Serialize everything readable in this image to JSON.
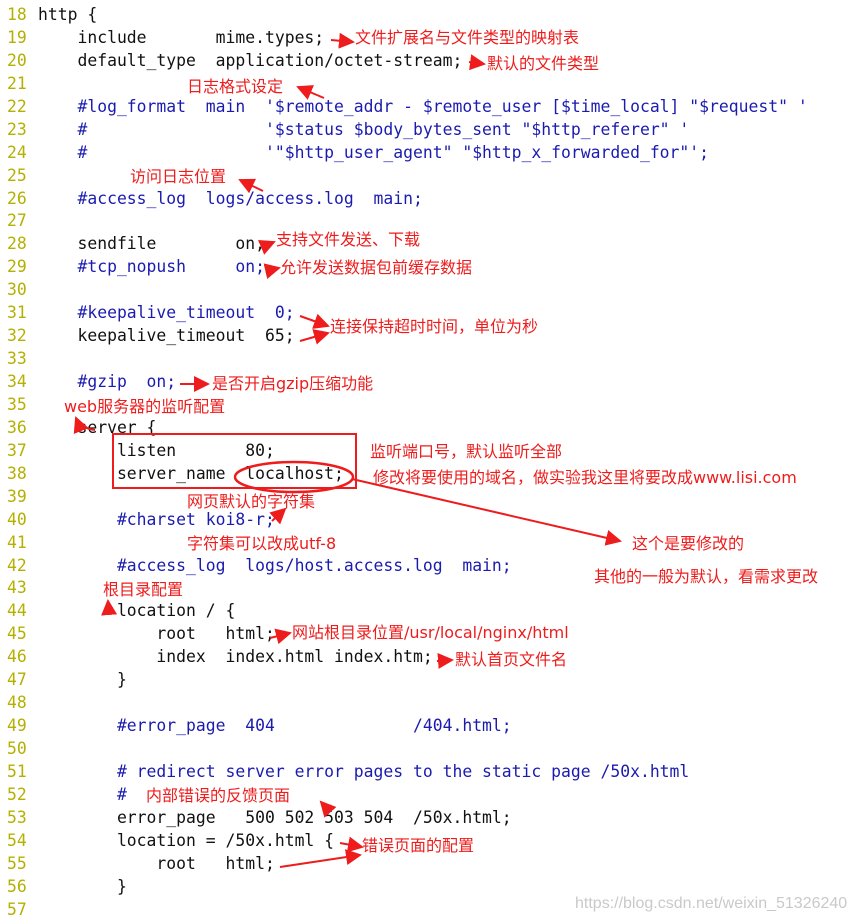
{
  "code_lines": [
    {
      "n": "18",
      "text": "http {",
      "comment": false
    },
    {
      "n": "19",
      "text": "    include       mime.types;",
      "comment": false
    },
    {
      "n": "20",
      "text": "    default_type  application/octet-stream;",
      "comment": false
    },
    {
      "n": "21",
      "text": "",
      "comment": false
    },
    {
      "n": "22",
      "text": "    #log_format  main  '$remote_addr - $remote_user [$time_local] \"$request\" '",
      "comment": true
    },
    {
      "n": "23",
      "text": "    #                  '$status $body_bytes_sent \"$http_referer\" '",
      "comment": true
    },
    {
      "n": "24",
      "text": "    #                  '\"$http_user_agent\" \"$http_x_forwarded_for\"';",
      "comment": true
    },
    {
      "n": "25",
      "text": "",
      "comment": false
    },
    {
      "n": "26",
      "text": "    #access_log  logs/access.log  main;",
      "comment": true
    },
    {
      "n": "27",
      "text": "",
      "comment": false
    },
    {
      "n": "28",
      "text": "    sendfile        on;",
      "comment": false
    },
    {
      "n": "29",
      "text": "    #tcp_nopush     on;",
      "comment": true
    },
    {
      "n": "30",
      "text": "",
      "comment": false
    },
    {
      "n": "31",
      "text": "    #keepalive_timeout  0;",
      "comment": true
    },
    {
      "n": "32",
      "text": "    keepalive_timeout  65;",
      "comment": false
    },
    {
      "n": "33",
      "text": "",
      "comment": false
    },
    {
      "n": "34",
      "text": "    #gzip  on;",
      "comment": true
    },
    {
      "n": "35",
      "text": "",
      "comment": false
    },
    {
      "n": "36",
      "text": "    server {",
      "comment": false
    },
    {
      "n": "37",
      "text": "        listen       80;",
      "comment": false
    },
    {
      "n": "38",
      "text": "        server_name  localhost;",
      "comment": false
    },
    {
      "n": "39",
      "text": "",
      "comment": false
    },
    {
      "n": "40",
      "text": "        #charset koi8-r;",
      "comment": true
    },
    {
      "n": "41",
      "text": "",
      "comment": false
    },
    {
      "n": "42",
      "text": "        #access_log  logs/host.access.log  main;",
      "comment": true
    },
    {
      "n": "43",
      "text": "",
      "comment": false
    },
    {
      "n": "44",
      "text": "        location / {",
      "comment": false
    },
    {
      "n": "45",
      "text": "            root   html;",
      "comment": false
    },
    {
      "n": "46",
      "text": "            index  index.html index.htm;",
      "comment": false
    },
    {
      "n": "47",
      "text": "        }",
      "comment": false
    },
    {
      "n": "48",
      "text": "",
      "comment": false
    },
    {
      "n": "49",
      "text": "        #error_page  404              /404.html;",
      "comment": true
    },
    {
      "n": "50",
      "text": "",
      "comment": false
    },
    {
      "n": "51",
      "text": "        # redirect server error pages to the static page /50x.html",
      "comment": true
    },
    {
      "n": "52",
      "text": "        #",
      "comment": true
    },
    {
      "n": "53",
      "text": "        error_page   500 502 503 504  /50x.html;",
      "comment": false
    },
    {
      "n": "54",
      "text": "        location = /50x.html {",
      "comment": false
    },
    {
      "n": "55",
      "text": "            root   html;",
      "comment": false
    },
    {
      "n": "56",
      "text": "        }",
      "comment": false
    },
    {
      "n": "57",
      "text": "",
      "comment": false
    }
  ],
  "annotations": {
    "mime": "文件扩展名与文件类型的映射表",
    "default_type": "默认的文件类型",
    "log_format": "日志格式设定",
    "access_log": "访问日志位置",
    "sendfile": "支持文件发送、下载",
    "tcp_nopush": "允许发送数据包前缓存数据",
    "keepalive": "连接保持超时时间，单位为秒",
    "gzip": "是否开启gzip压缩功能",
    "server": "web服务器的监听配置",
    "listen": "监听端口号，默认监听全部",
    "server_name": "修改将要使用的域名，做实验我这里将要改成www.lisi.com",
    "charset": "网页默认的字符集",
    "charset_utf8": "字符集可以改成utf-8",
    "must_modify": "这个是要修改的",
    "others_default": "其他的一般为默认，看需求更改",
    "location_root": "根目录配置",
    "root": "网站根目录位置/usr/local/nginx/html",
    "index": "默认首页文件名",
    "internal_error": "内部错误的反馈页面",
    "error_page_config": "错误页面的配置"
  },
  "watermark": "https://blog.csdn.net/weixin_51326240",
  "colors": {
    "annotation": "#ee1c1c",
    "comment": "#1b1bb0",
    "line_number": "#b5b000"
  }
}
